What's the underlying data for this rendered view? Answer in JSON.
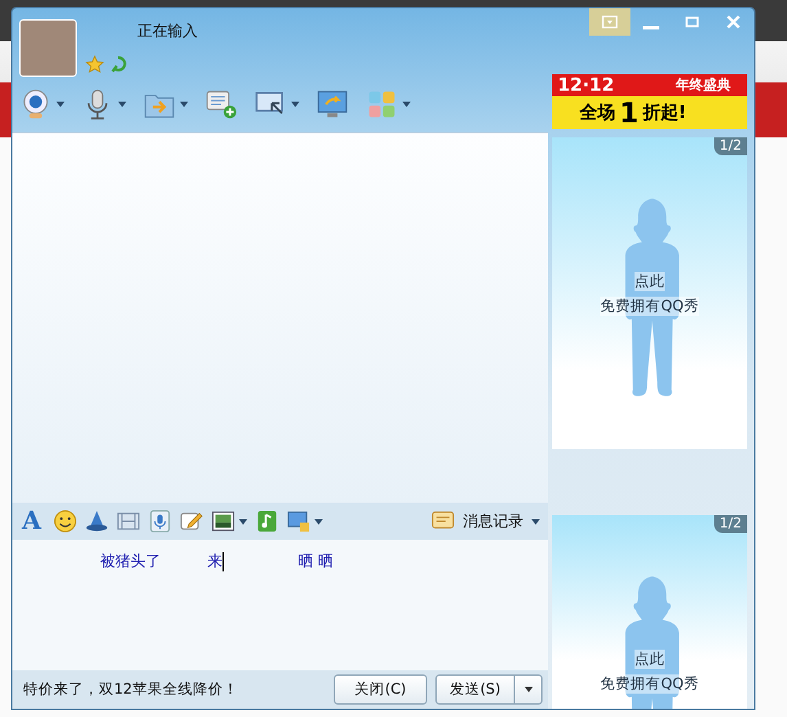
{
  "window": {
    "status": "正在输入",
    "controls": [
      {
        "kind": "menu"
      },
      {
        "kind": "minimize"
      },
      {
        "kind": "maximize"
      },
      {
        "kind": "close"
      }
    ]
  },
  "toolbar": [
    {
      "kind": "webcam",
      "dropdown": true
    },
    {
      "kind": "mic",
      "dropdown": true
    },
    {
      "kind": "folder",
      "dropdown": true
    },
    {
      "kind": "chat-add",
      "dropdown": false
    },
    {
      "kind": "screen",
      "dropdown": true
    },
    {
      "kind": "monitor",
      "dropdown": false
    },
    {
      "kind": "apps",
      "dropdown": true
    }
  ],
  "ad_banner": {
    "date": "12·12",
    "event": "年终盛典",
    "prefix": "全场",
    "number": "1",
    "suffix": "折起!"
  },
  "format_toolbar": {
    "font_label": "A",
    "tools": [
      {
        "kind": "smiley",
        "dropdown": false
      },
      {
        "kind": "hat",
        "dropdown": false
      },
      {
        "kind": "film",
        "dropdown": false
      },
      {
        "kind": "mic",
        "dropdown": false
      },
      {
        "kind": "note",
        "dropdown": false
      },
      {
        "kind": "image",
        "dropdown": true
      },
      {
        "kind": "music",
        "dropdown": false
      },
      {
        "kind": "capture",
        "dropdown": true
      }
    ],
    "history_label": "消息记录"
  },
  "message_input": {
    "words": [
      "被猪头了",
      "来",
      "晒 晒"
    ]
  },
  "footer": {
    "promo": "特价来了，双12苹果全线降价！",
    "close_label": "关闭(C)",
    "send_label": "发送(S)"
  },
  "show_panels": [
    {
      "page": "1/2",
      "line1": "点此",
      "line2": "免费拥有QQ秀"
    },
    {
      "page": "1/2",
      "line1": "点此",
      "line2": "免费拥有QQ秀"
    }
  ]
}
